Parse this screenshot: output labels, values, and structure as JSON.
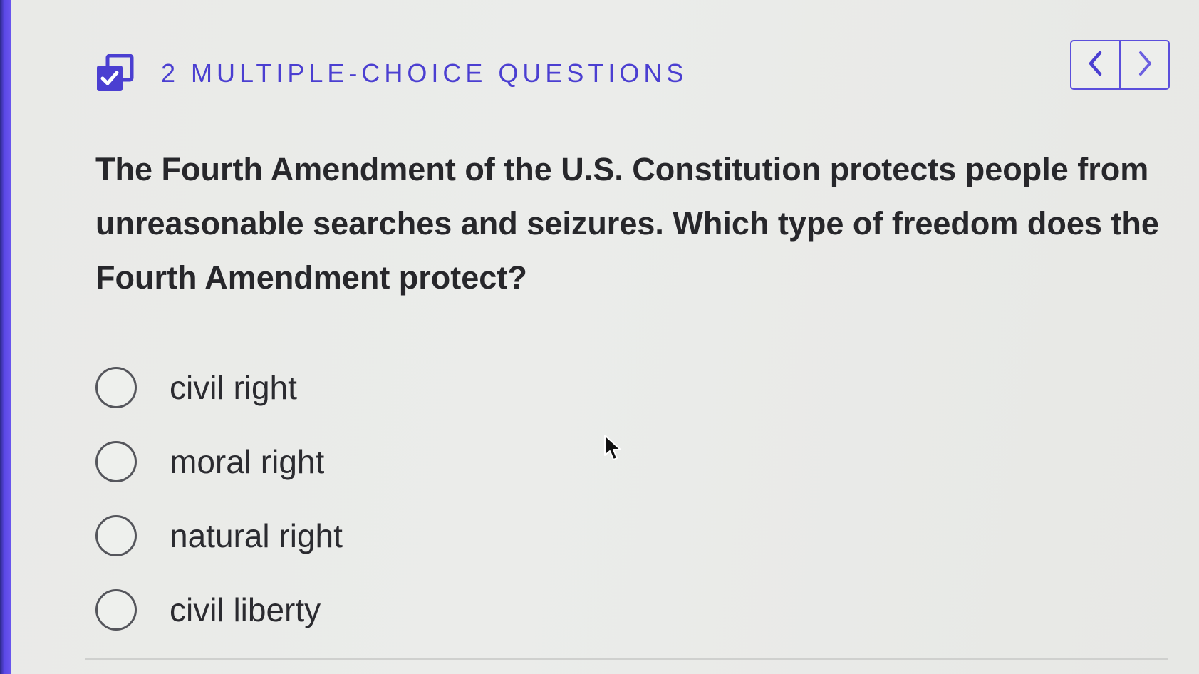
{
  "header": {
    "title": "2 MULTIPLE-CHOICE QUESTIONS",
    "icon": "checkbox-stack-icon"
  },
  "nav": {
    "prev_icon": "chevron-left-icon",
    "next_icon": "chevron-right-icon"
  },
  "question": {
    "text": "The Fourth Amendment of the U.S. Constitution protects people from unreasonable searches and seizures. Which type of freedom does the Fourth Amendment protect?"
  },
  "options": [
    {
      "label": "civil right"
    },
    {
      "label": "moral right"
    },
    {
      "label": "natural right"
    },
    {
      "label": "civil liberty"
    }
  ],
  "colors": {
    "accent": "#4b3fd1",
    "sidebar": "#6b57f0",
    "text": "#27272b"
  }
}
